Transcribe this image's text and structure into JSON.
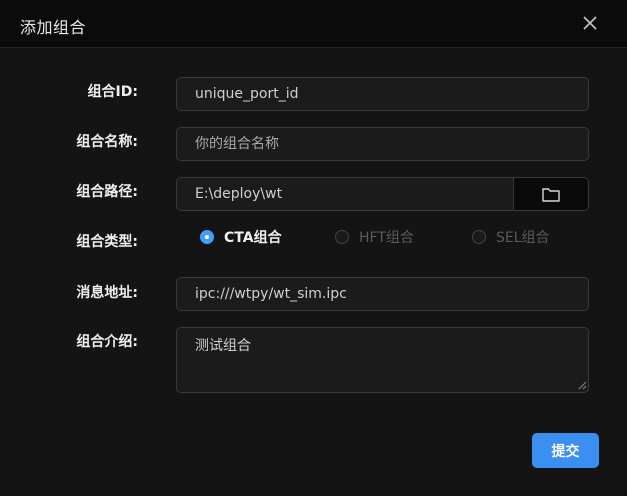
{
  "dialog": {
    "title": "添加组合",
    "close_icon": "close-icon"
  },
  "form": {
    "id_label": "组合ID:",
    "id_value": "unique_port_id",
    "name_label": "组合名称:",
    "name_placeholder": "你的组合名称",
    "path_label": "组合路径:",
    "path_value": "E:\\deploy\\wt",
    "path_button_icon": "folder-icon",
    "type_label": "组合类型:",
    "type_options": [
      {
        "label": "CTA组合",
        "checked": true
      },
      {
        "label": "HFT组合",
        "checked": false
      },
      {
        "label": "SEL组合",
        "checked": false
      }
    ],
    "msg_label": "消息地址:",
    "msg_value": "ipc:///wtpy/wt_sim.ipc",
    "intro_label": "组合介绍:",
    "intro_value": "测试组合"
  },
  "actions": {
    "submit_label": "提交"
  },
  "colors": {
    "accent": "#409eff",
    "submit": "#3b8ff0"
  }
}
